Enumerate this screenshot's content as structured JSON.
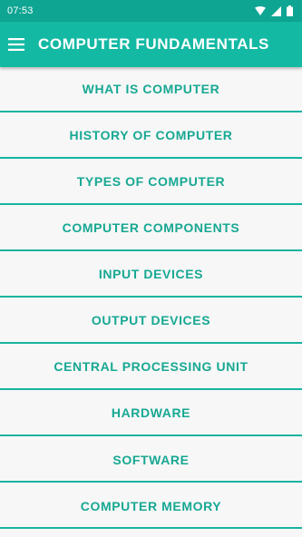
{
  "status_bar": {
    "time": "07:53",
    "icons": [
      "wifi-icon",
      "signal-icon",
      "battery-icon"
    ]
  },
  "app_bar": {
    "menu_icon": "hamburger-menu-icon",
    "title": "COMPUTER FUNDAMENTALS"
  },
  "topics": [
    {
      "label": "WHAT IS COMPUTER"
    },
    {
      "label": "HISTORY OF COMPUTER"
    },
    {
      "label": "TYPES OF COMPUTER"
    },
    {
      "label": "COMPUTER COMPONENTS"
    },
    {
      "label": "INPUT DEVICES"
    },
    {
      "label": "OUTPUT DEVICES"
    },
    {
      "label": "CENTRAL PROCESSING UNIT"
    },
    {
      "label": "HARDWARE"
    },
    {
      "label": "SOFTWARE"
    },
    {
      "label": "COMPUTER MEMORY"
    }
  ],
  "colors": {
    "status_bar": "#0fa593",
    "app_bar": "#14b9a3",
    "item_text": "#17a893",
    "divider": "#17b3a0",
    "background": "#f7f7f7"
  }
}
